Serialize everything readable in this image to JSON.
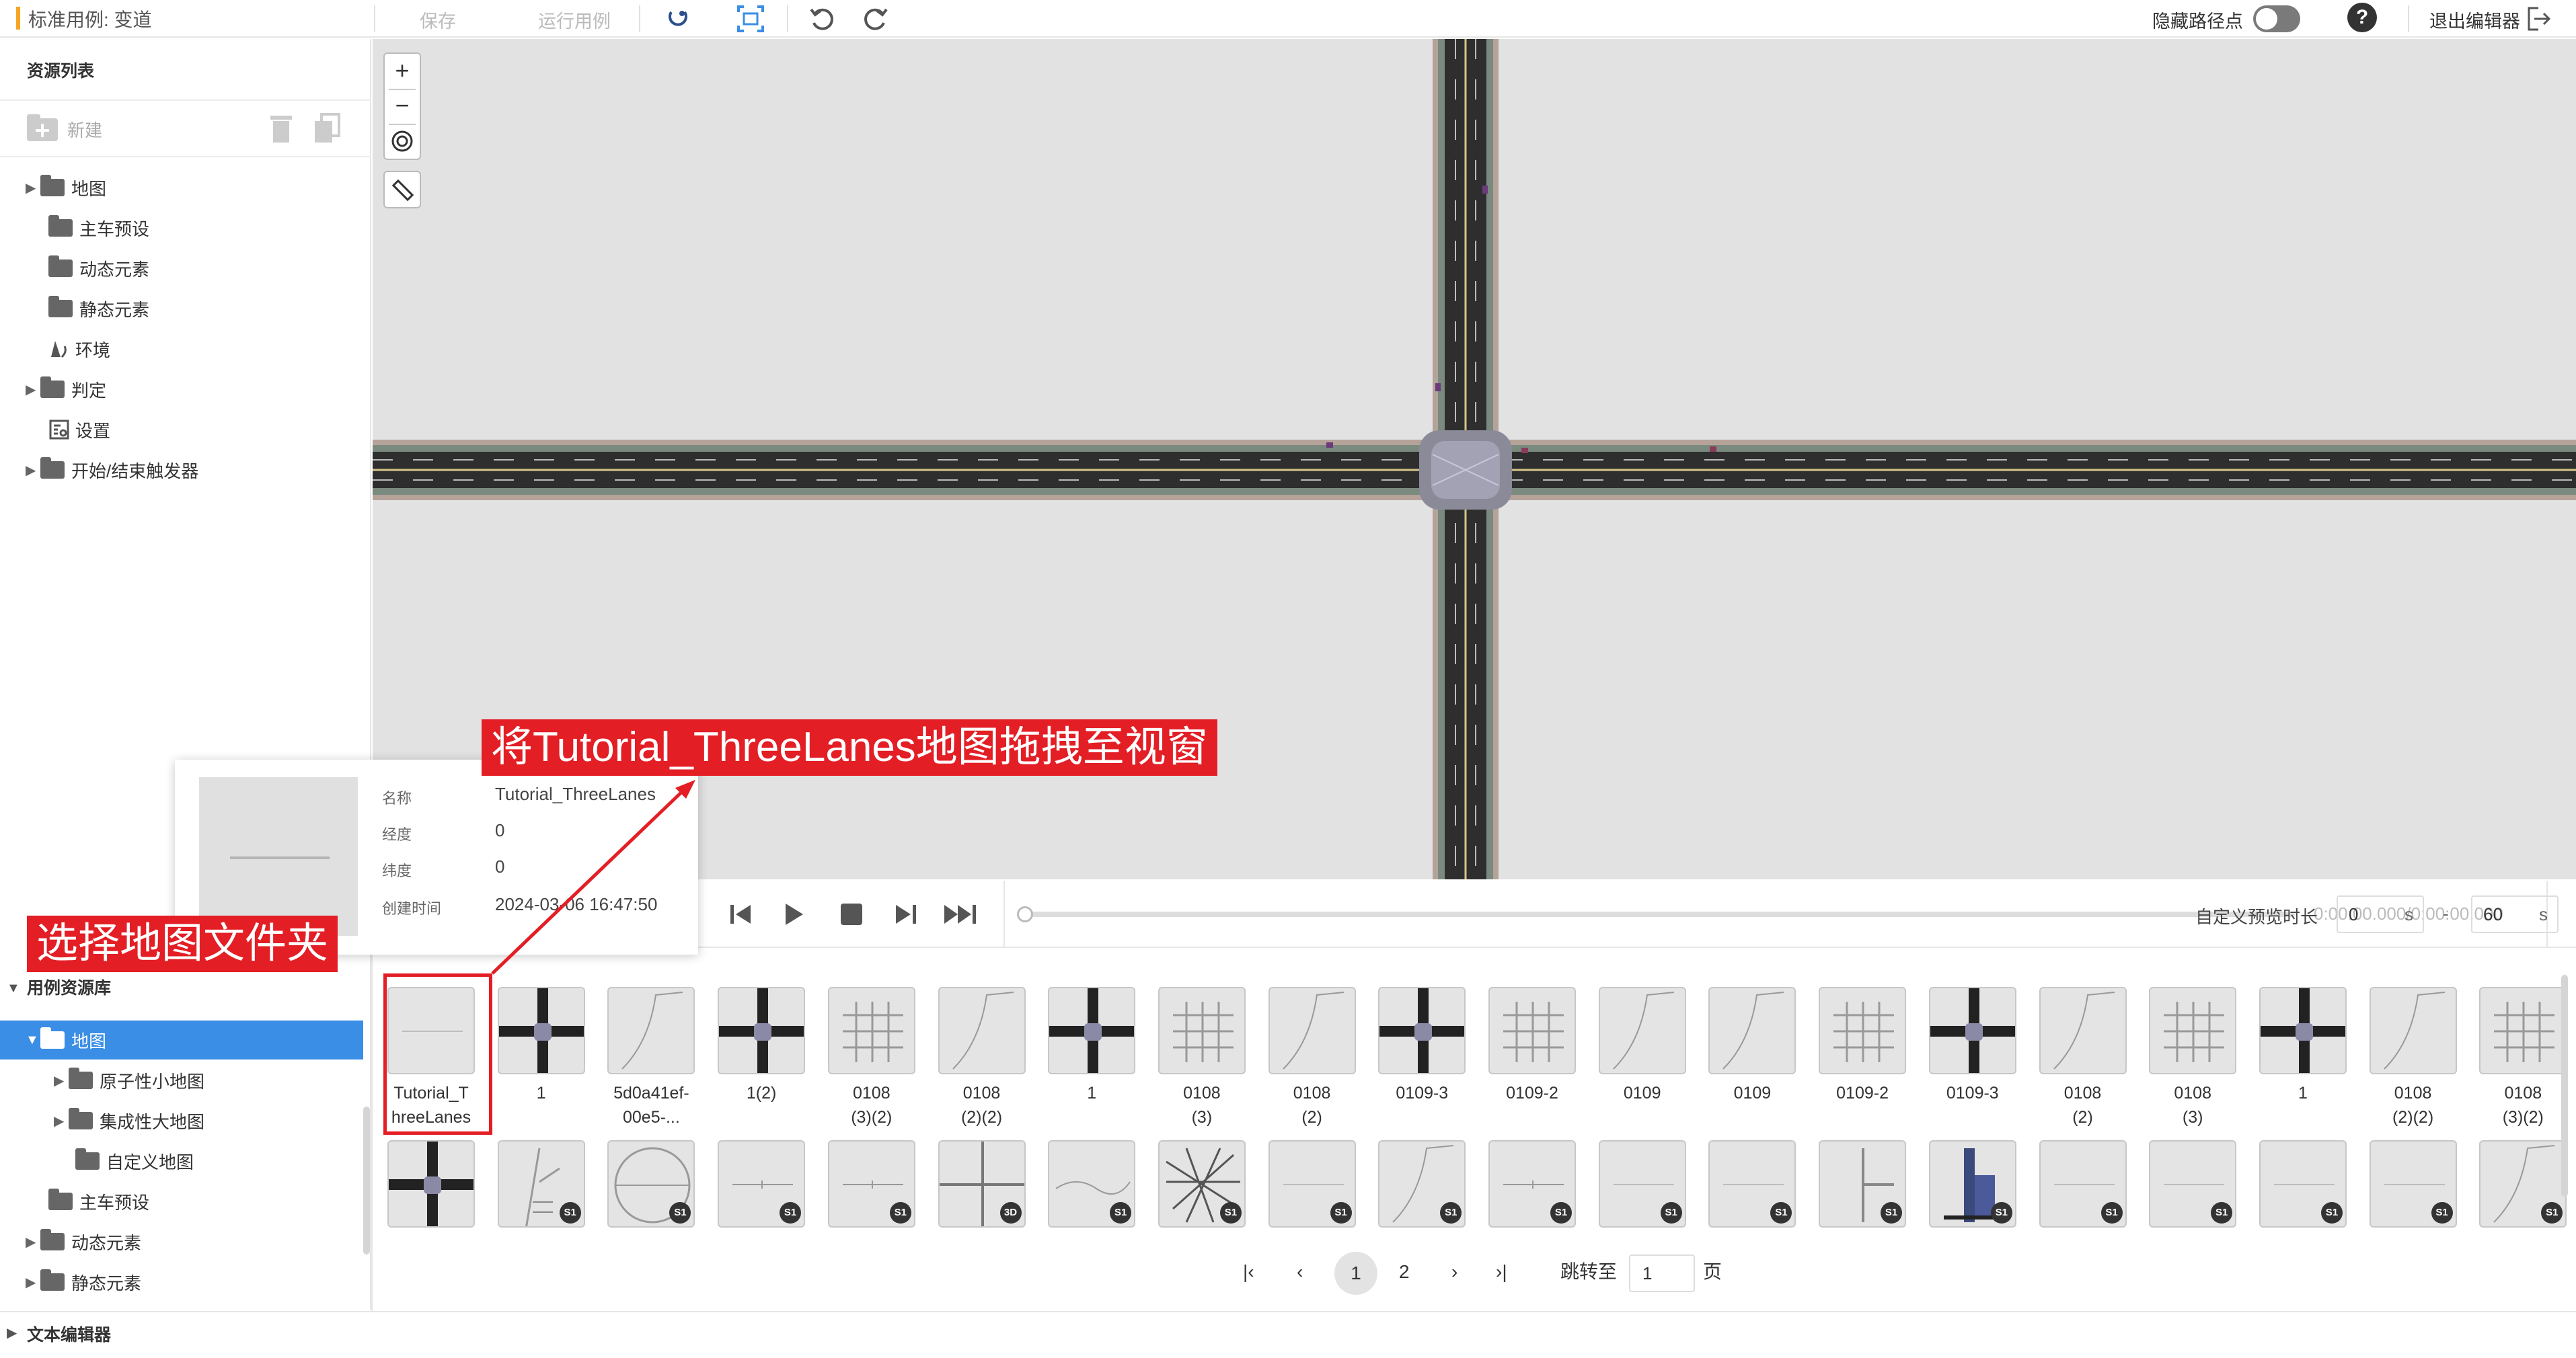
{
  "header": {
    "title": "标准用例: 变道",
    "save": "保存",
    "run_case": "运行用例",
    "hide_waypoints": "隐藏路径点",
    "help": "?",
    "exit_editor": "退出编辑器"
  },
  "resource_list": {
    "title": "资源列表",
    "new_label": "新建",
    "items": [
      {
        "label": "地图",
        "expandable": true
      },
      {
        "label": "主车预设",
        "expandable": false
      },
      {
        "label": "动态元素",
        "expandable": false
      },
      {
        "label": "静态元素",
        "expandable": false
      },
      {
        "label": "环境",
        "expandable": false
      },
      {
        "label": "判定",
        "expandable": true
      },
      {
        "label": "设置",
        "expandable": false
      },
      {
        "label": "开始/结束触发器",
        "expandable": true
      }
    ]
  },
  "viewport": {
    "zoom_in": "+",
    "zoom_out": "−"
  },
  "playback": {
    "time": "0:00:00.000/0:00:00.000",
    "preview_label": "自定义预览时长",
    "start_value": "0",
    "start_unit": "s",
    "dash": "-",
    "end_value": "60",
    "end_unit": "s"
  },
  "library": {
    "title": "用例资源库",
    "items": [
      {
        "label": "地图",
        "level": 1,
        "selected": true
      },
      {
        "label": "原子性小地图",
        "level": 2
      },
      {
        "label": "集成性大地图",
        "level": 2
      },
      {
        "label": "自定义地图",
        "level": 2
      },
      {
        "label": "主车预设",
        "level": 1
      },
      {
        "label": "动态元素",
        "level": 1
      },
      {
        "label": "静态元素",
        "level": 1
      }
    ],
    "row1": [
      "Tutorial_T\nhreeLanes",
      "1",
      "5d0a41ef-\n00e5-...",
      "1(2)",
      "0108\n(3)(2)",
      "0108\n(2)(2)",
      "1",
      "0108\n(3)",
      "0108\n(2)",
      "0109-3",
      "0109-2",
      "0109",
      "0109",
      "0109-2",
      "0109-3",
      "0108\n(2)",
      "0108\n(3)",
      "1",
      "0108\n(2)(2)",
      "0108\n(3)(2)"
    ],
    "badge_text": "S1",
    "badge_alt": "3D"
  },
  "pagination": {
    "first": "|‹",
    "prev": "‹",
    "pages": [
      "1",
      "2"
    ],
    "next": "›",
    "last": "›|",
    "jump_label": "跳转至",
    "jump_value": "1",
    "page_unit": "页"
  },
  "text_editor": "文本编辑器",
  "popup": {
    "name_key": "名称",
    "name_val": "Tutorial_ThreeLanes",
    "lon_key": "经度",
    "lon_val": "0",
    "lat_key": "纬度",
    "lat_val": "0",
    "time_key": "创建时间",
    "time_val": "2024-03-06 16:47:50"
  },
  "annotations": {
    "drag": "将Tutorial_ThreeLanes地图拖拽至视窗",
    "select": "选择地图文件夹"
  },
  "colors": {
    "accent": "#3a8ee6",
    "annotation": "#e31e25",
    "title_bar": "#f5a623"
  }
}
